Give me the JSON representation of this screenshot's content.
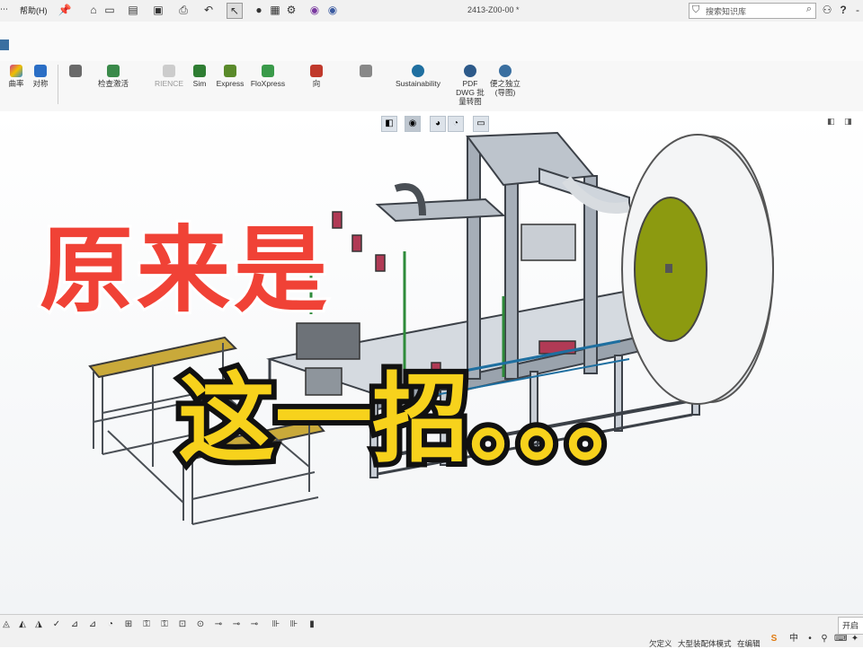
{
  "titlebar": {
    "help_menu": "帮助(H)",
    "document_title": "2413-Z00-00 *",
    "search_placeholder": "搜索知识库",
    "help_icon": "?",
    "minimize_icon": "-"
  },
  "ribbon": {
    "items": [
      {
        "label": "曲率",
        "icon": "curvature-icon",
        "color": "#d23a8a"
      },
      {
        "label": "对称",
        "icon": "symmetry-icon",
        "color": "#2a6ec5"
      },
      {
        "label": "检查激活",
        "icon": "check-icon",
        "color": "#3a8a4a"
      },
      {
        "label": "RIENCE",
        "icon": "experience-icon",
        "color": "#b0b0b0"
      },
      {
        "label": "Sim",
        "icon": "simulation-icon",
        "color": "#2e7d32"
      },
      {
        "label": "Express",
        "icon": "simxpress-icon",
        "color": "#5a8a2a"
      },
      {
        "label": "FloXpress",
        "icon": "floxpress-icon",
        "color": "#3a9a4a"
      },
      {
        "label": "向",
        "icon": "direction-icon",
        "color": "#c0392b"
      },
      {
        "label": "Sustainability",
        "icon": "sustainability-icon",
        "color": "#1f6fa0"
      },
      {
        "label": "PDF DWG 批量转图",
        "icon": "pdf-dwg-icon",
        "color": "#2d5a8a"
      },
      {
        "label": "便之独立(导图)",
        "icon": "export-icon",
        "color": "#3a6fa0"
      }
    ]
  },
  "overlay": {
    "line1": "原来是",
    "line2": "这一招。。。"
  },
  "statusbar": {
    "items": [
      "欠定义",
      "大型装配体模式",
      "在编辑",
      "开启"
    ]
  },
  "colors": {
    "overlay_red": "#f04236",
    "overlay_yellow": "#f7d21c",
    "disc_green": "#8c9a10",
    "frame_gray": "#9aa3ad"
  }
}
